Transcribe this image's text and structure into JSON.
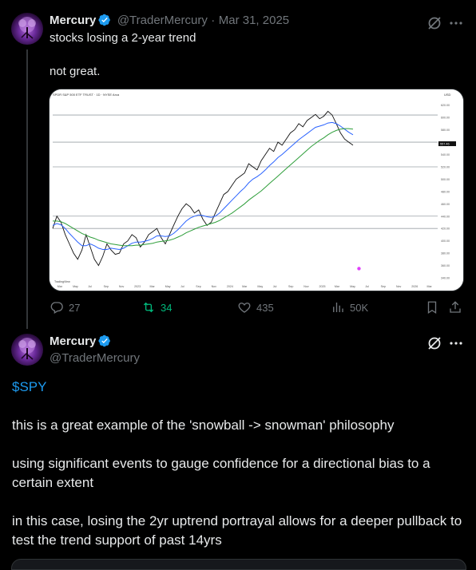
{
  "tweet1": {
    "name": "Mercury",
    "handle": "@TraderMercury",
    "sep": "·",
    "date": "Mar 31, 2025",
    "line1": "stocks losing a 2-year trend",
    "line2": "not great.",
    "stats": {
      "replies": "27",
      "reposts": "34",
      "likes": "435",
      "views": "50K"
    }
  },
  "tweet2": {
    "name": "Mercury",
    "handle": "@TraderMercury",
    "cashtag": "$SPY",
    "p1": "this is a great example of the 'snowball -> snowman' philosophy",
    "p2": "using significant events to gauge confidence for a directional bias to a certain extent",
    "p3": "in this case, losing the 2yr uptrend portrayal allows for a deeper pullback to test the trend support of past 14yrs"
  },
  "colors": {
    "accent": "#1d9bf0",
    "repost": "#00ba7c",
    "muted": "#71767b",
    "text": "#e7e9ea"
  },
  "chart_data": {
    "type": "line",
    "header": "SPDR S&P 500 ETF TRUST · 1D · NYSE Arca",
    "currency": "USD",
    "price_tag": "557.46",
    "watermark": "TradingView",
    "x": [
      "Mar",
      "May",
      "Jul",
      "Sep",
      "Nov",
      "2023",
      "Mar",
      "May",
      "Jul",
      "Sep",
      "Nov",
      "2024",
      "Mar",
      "May",
      "Jul",
      "Sep",
      "Nov",
      "2025",
      "Mar",
      "May",
      "Jul",
      "Sep",
      "Nov",
      "2026",
      "Mar"
    ],
    "y_ticks": [
      "620.00",
      "600.00",
      "580.00",
      "560.00",
      "540.00",
      "520.00",
      "500.00",
      "480.00",
      "460.00",
      "440.00",
      "420.00",
      "400.00",
      "380.00",
      "360.00",
      "340.00"
    ],
    "series": [
      {
        "values": [
          420,
          440,
          430,
          410,
          395,
          380,
          370,
          385,
          410,
          390,
          370,
          360,
          375,
          395,
          385,
          378,
          380,
          395,
          400,
          410,
          405,
          390,
          398,
          410,
          415,
          420,
          405,
          395,
          410,
          425,
          440,
          452,
          460,
          455,
          445,
          450,
          435,
          425,
          430,
          445,
          460,
          475,
          480,
          490,
          500,
          505,
          510,
          525,
          520,
          515,
          530,
          540,
          550,
          545,
          560,
          555,
          565,
          575,
          580,
          590,
          585,
          595,
          600,
          605,
          598,
          602,
          610,
          604,
          590,
          575,
          565,
          560,
          555
        ]
      },
      {
        "values": [
          425,
          428,
          426,
          420,
          412,
          405,
          398,
          392,
          392,
          395,
          392,
          388,
          386,
          386,
          388,
          387,
          386,
          388,
          392,
          396,
          398,
          398,
          399,
          401,
          404,
          408,
          408,
          407,
          408,
          412,
          418,
          425,
          432,
          437,
          440,
          442,
          441,
          439,
          438,
          440,
          445,
          452,
          459,
          466,
          473,
          480,
          486,
          494,
          500,
          504,
          509,
          515,
          522,
          528,
          535,
          540,
          546,
          552,
          558,
          564,
          569,
          574,
          579,
          584,
          586,
          588,
          591,
          592,
          590,
          586,
          581,
          576,
          572
        ]
      },
      {
        "values": [
          432,
          432,
          431,
          428,
          424,
          420,
          416,
          412,
          409,
          406,
          404,
          401,
          399,
          397,
          395,
          394,
          393,
          392,
          392,
          392,
          393,
          393,
          394,
          395,
          396,
          398,
          399,
          400,
          401,
          403,
          406,
          409,
          413,
          416,
          419,
          422,
          424,
          426,
          428,
          430,
          433,
          437,
          441,
          445,
          450,
          455,
          460,
          466,
          471,
          476,
          481,
          487,
          493,
          499,
          505,
          511,
          517,
          523,
          529,
          535,
          541,
          547,
          553,
          558,
          563,
          567,
          572,
          576,
          579,
          581,
          582,
          582,
          581
        ]
      }
    ],
    "hlines": [
      604,
      560,
      520,
      440,
      420
    ],
    "ylim": [
      340,
      630
    ]
  }
}
